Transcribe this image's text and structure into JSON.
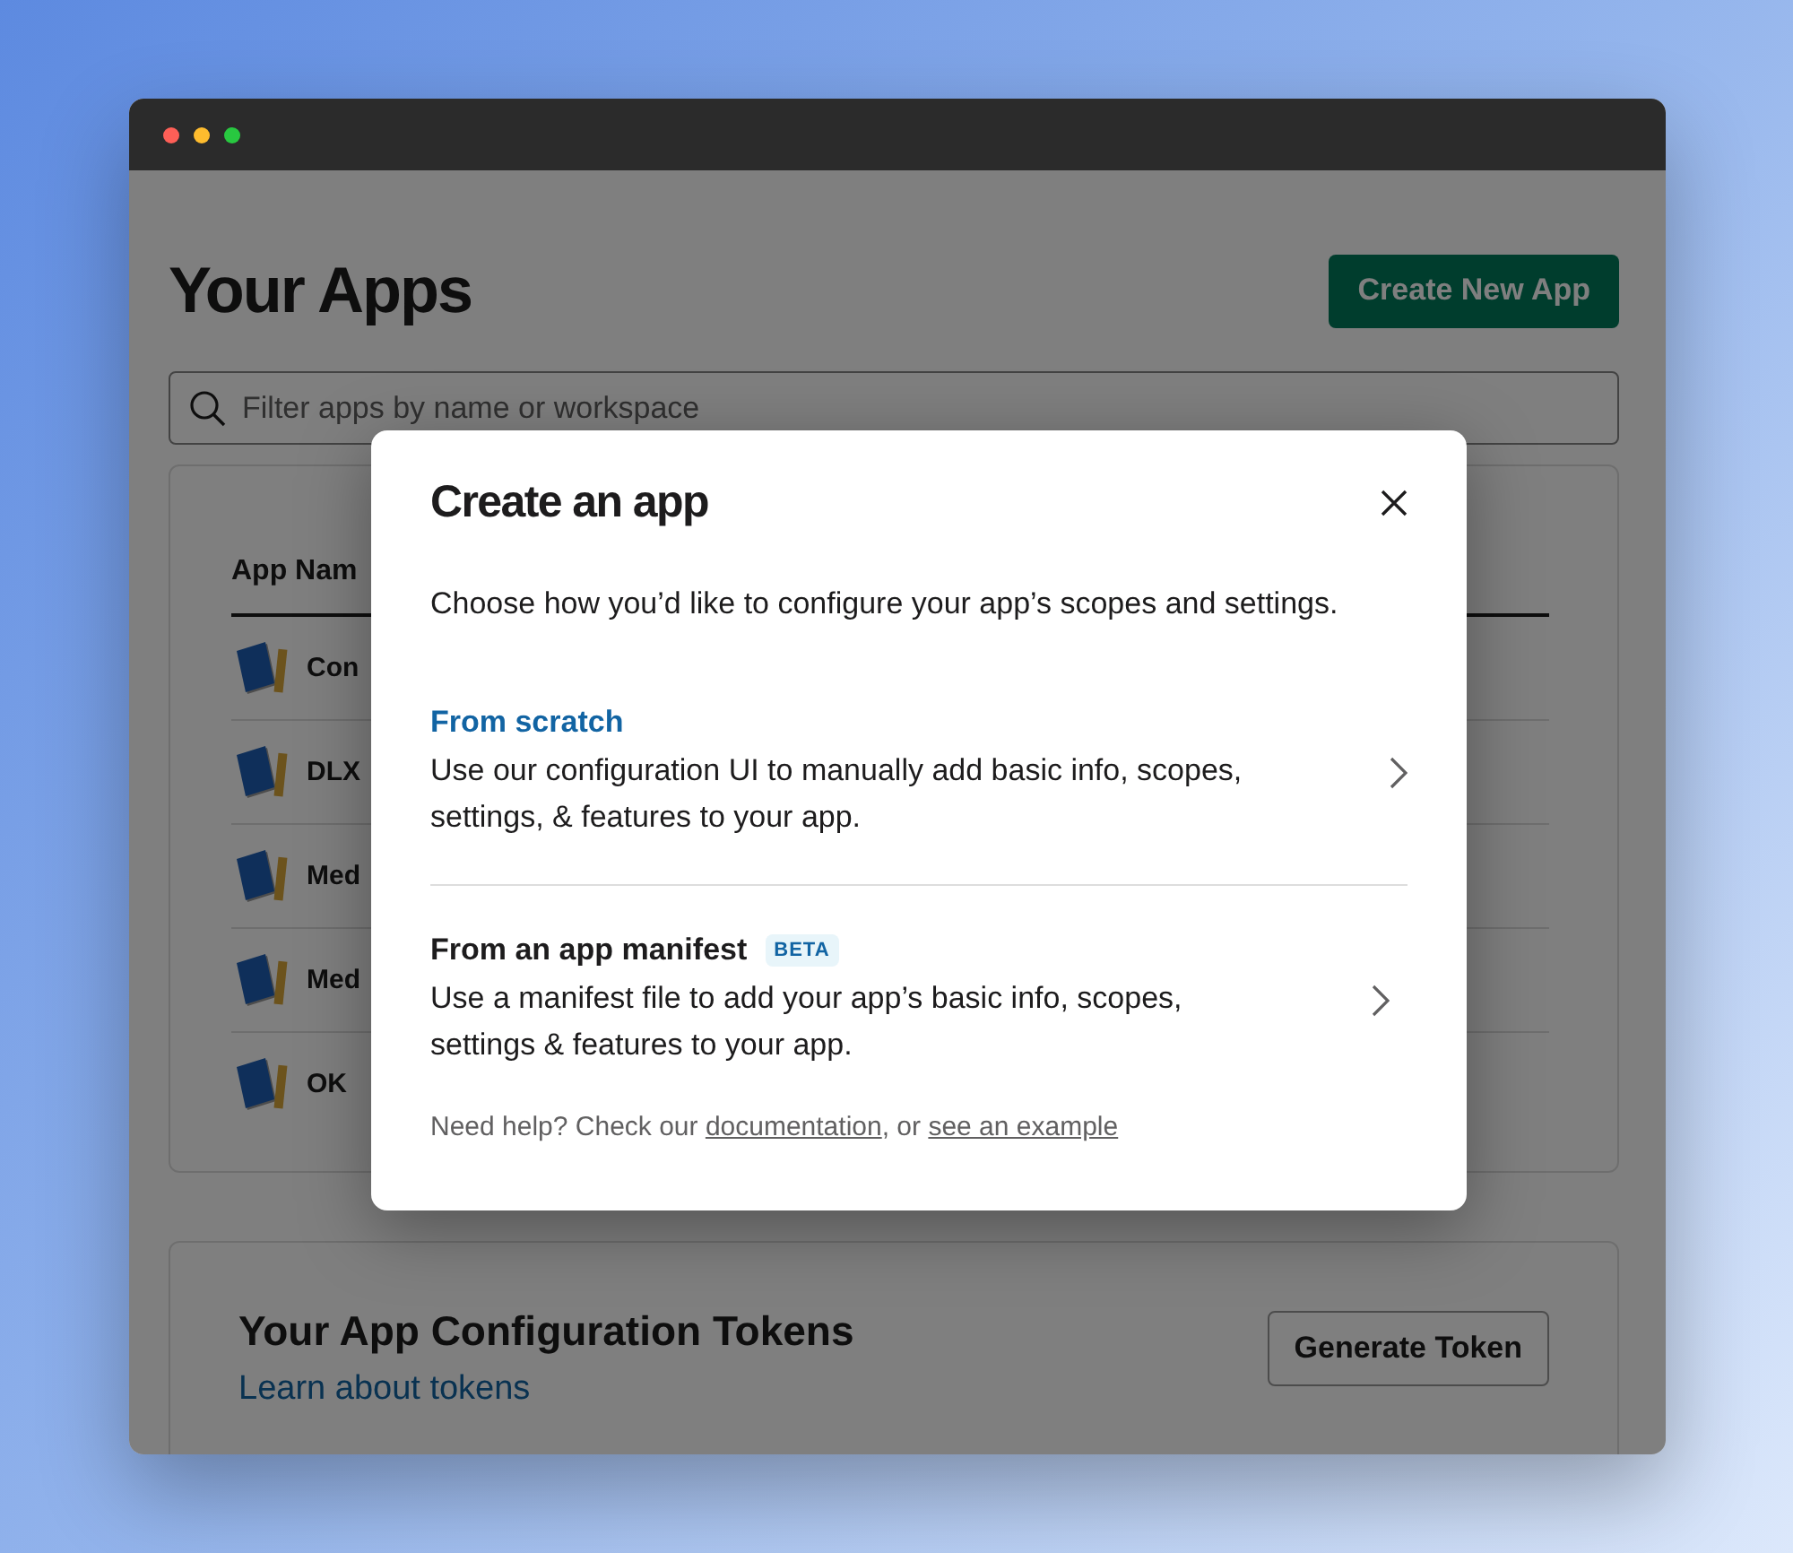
{
  "page": {
    "title": "Your Apps",
    "create_button": "Create New App",
    "search": {
      "placeholder": "Filter apps by name or workspace"
    }
  },
  "apps_table": {
    "columns": [
      "App Nam"
    ],
    "rows": [
      {
        "name": "Con"
      },
      {
        "name": "DLX"
      },
      {
        "name": "Med"
      },
      {
        "name": "Med"
      },
      {
        "name": "OK"
      }
    ]
  },
  "tokens": {
    "title": "Your App Configuration Tokens",
    "link": "Learn about tokens",
    "button": "Generate Token"
  },
  "modal": {
    "title": "Create an app",
    "intro": "Choose how you’d like to configure your app’s scopes and settings.",
    "options": [
      {
        "title": "From scratch",
        "description": "Use our configuration UI to manually add basic info, scopes, settings, & features to your app.",
        "selected": true
      },
      {
        "title": "From an app manifest",
        "badge": "BETA",
        "description": "Use a manifest file to add your app’s basic info, scopes, settings & features to your app.",
        "selected": false
      }
    ],
    "help": {
      "text": "Need help? Check our",
      "link_1": "documentation",
      "separator": ", or",
      "link_2": "see an example"
    }
  }
}
